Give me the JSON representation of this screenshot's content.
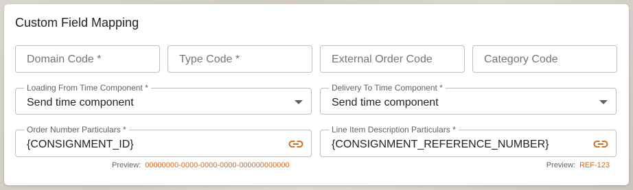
{
  "card": {
    "title": "Custom Field Mapping"
  },
  "row1": {
    "domain_code_placeholder": "Domain Code *",
    "type_code_placeholder": "Type Code *",
    "external_order_code_placeholder": "External Order Code",
    "category_code_placeholder": "Category Code"
  },
  "loading_from": {
    "label": "Loading From Time Component *",
    "value": "Send time component"
  },
  "delivery_to": {
    "label": "Delivery To Time Component *",
    "value": "Send time component"
  },
  "order_number": {
    "label": "Order Number Particulars *",
    "value": "{CONSIGNMENT_ID}",
    "preview_label": "Preview:",
    "preview_value": "00000000-0000-0000-0000-000000000000"
  },
  "line_item": {
    "label": "Line Item Description Particulars *",
    "value": "{CONSIGNMENT_REFERENCE_NUMBER}",
    "preview_label": "Preview:",
    "preview_value": "REF-123"
  },
  "colors": {
    "accent": "#d2691e",
    "border": "#bdbdbd"
  },
  "icons": {
    "dropdown": "chevron-down-icon",
    "link": "link-icon"
  }
}
